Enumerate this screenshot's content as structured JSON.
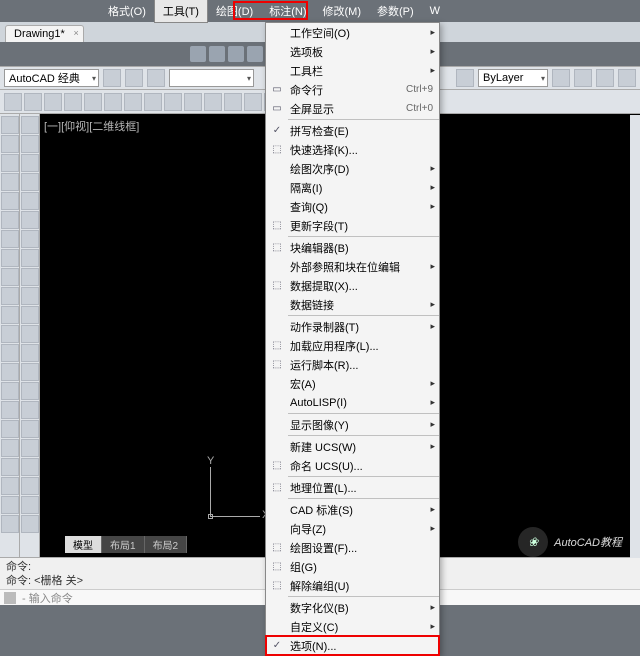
{
  "menubar": {
    "items": [
      "格式(O)",
      "工具(T)",
      "绘图(D)",
      "标注(N)",
      "修改(M)",
      "参数(P)",
      "W"
    ],
    "active_index": 1
  },
  "doc_tab": "Drawing1*",
  "style_combo": "AutoCAD 经典",
  "layer_combo": "ByLayer",
  "canvas_label": "[一][仰视][二维线框]",
  "ucs": {
    "y": "Y",
    "x": "X"
  },
  "layout_tabs": [
    "模型",
    "布局1",
    "布局2"
  ],
  "cmd": {
    "line1": "命令:",
    "line2": "命令:  <栅格 关>",
    "input": "- 输入命令"
  },
  "dropdown": [
    {
      "t": "item",
      "label": "工作空间(O)",
      "sub": true
    },
    {
      "t": "item",
      "label": "选项板",
      "sub": true
    },
    {
      "t": "item",
      "label": "工具栏",
      "sub": true
    },
    {
      "t": "item",
      "label": "命令行",
      "shortcut": "Ctrl+9",
      "icon": "▭"
    },
    {
      "t": "item",
      "label": "全屏显示",
      "shortcut": "Ctrl+0",
      "icon": "▭"
    },
    {
      "t": "sep"
    },
    {
      "t": "item",
      "label": "拼写检查(E)",
      "icon": "✓"
    },
    {
      "t": "item",
      "label": "快速选择(K)...",
      "icon": "⬚"
    },
    {
      "t": "item",
      "label": "绘图次序(D)",
      "sub": true
    },
    {
      "t": "item",
      "label": "隔离(I)",
      "sub": true
    },
    {
      "t": "item",
      "label": "查询(Q)",
      "sub": true
    },
    {
      "t": "item",
      "label": "更新字段(T)",
      "icon": "⬚"
    },
    {
      "t": "sep"
    },
    {
      "t": "item",
      "label": "块编辑器(B)",
      "icon": "⬚"
    },
    {
      "t": "item",
      "label": "外部参照和块在位编辑",
      "sub": true
    },
    {
      "t": "item",
      "label": "数据提取(X)...",
      "icon": "⬚"
    },
    {
      "t": "item",
      "label": "数据链接",
      "sub": true
    },
    {
      "t": "sep"
    },
    {
      "t": "item",
      "label": "动作录制器(T)",
      "sub": true
    },
    {
      "t": "item",
      "label": "加载应用程序(L)...",
      "icon": "⬚"
    },
    {
      "t": "item",
      "label": "运行脚本(R)...",
      "icon": "⬚"
    },
    {
      "t": "item",
      "label": "宏(A)",
      "sub": true
    },
    {
      "t": "item",
      "label": "AutoLISP(I)",
      "sub": true
    },
    {
      "t": "sep"
    },
    {
      "t": "item",
      "label": "显示图像(Y)",
      "sub": true
    },
    {
      "t": "sep"
    },
    {
      "t": "item",
      "label": "新建 UCS(W)",
      "sub": true
    },
    {
      "t": "item",
      "label": "命名 UCS(U)...",
      "icon": "⬚"
    },
    {
      "t": "sep"
    },
    {
      "t": "item",
      "label": "地理位置(L)...",
      "icon": "⬚"
    },
    {
      "t": "sep"
    },
    {
      "t": "item",
      "label": "CAD 标准(S)",
      "sub": true
    },
    {
      "t": "item",
      "label": "向导(Z)",
      "sub": true
    },
    {
      "t": "item",
      "label": "绘图设置(F)...",
      "icon": "⬚"
    },
    {
      "t": "item",
      "label": "组(G)",
      "icon": "⬚"
    },
    {
      "t": "item",
      "label": "解除编组(U)",
      "icon": "⬚"
    },
    {
      "t": "sep"
    },
    {
      "t": "item",
      "label": "数字化仪(B)",
      "sub": true
    },
    {
      "t": "item",
      "label": "自定义(C)",
      "sub": true
    },
    {
      "t": "item",
      "label": "选项(N)...",
      "icon": "✓",
      "hl": true
    }
  ],
  "brand": "AutoCAD教程"
}
